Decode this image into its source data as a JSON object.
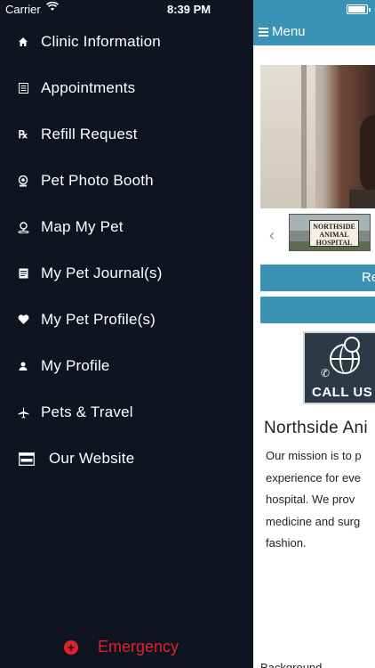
{
  "status_bar": {
    "carrier": "Carrier",
    "time": "8:39 PM",
    "battery_level": 0.95
  },
  "drawer": {
    "items": [
      {
        "label": "Clinic Information",
        "icon": "home-icon"
      },
      {
        "label": "Appointments",
        "icon": "calendar-icon"
      },
      {
        "label": "Refill Request",
        "icon": "prescription-icon"
      },
      {
        "label": "Pet Photo Booth",
        "icon": "camera-icon"
      },
      {
        "label": "Map My Pet",
        "icon": "map-pin-icon"
      },
      {
        "label": "My Pet Journal(s)",
        "icon": "journal-icon"
      },
      {
        "label": "My Pet Profile(s)",
        "icon": "heart-icon"
      },
      {
        "label": "My Profile",
        "icon": "user-icon"
      },
      {
        "label": "Pets & Travel",
        "icon": "airplane-icon"
      },
      {
        "label": "Our Website",
        "icon": "www-icon"
      }
    ],
    "emergency": {
      "label": "Emergency",
      "color": "#e0222a"
    }
  },
  "main": {
    "topbar": {
      "menu_label": "Menu",
      "color": "#3a93b5"
    },
    "sign_text": "NORTHSIDE ANIMAL HOSPITAL",
    "button1_label": "Re",
    "button2_label": "",
    "callus_label": "CALL US",
    "heading": "Northside Ani",
    "paragraph_lines": [
      "Our mission is to p",
      "experience for eve",
      "hospital.  We prov",
      "medicine and surg",
      "fashion."
    ],
    "bottom_heading": "Background"
  }
}
